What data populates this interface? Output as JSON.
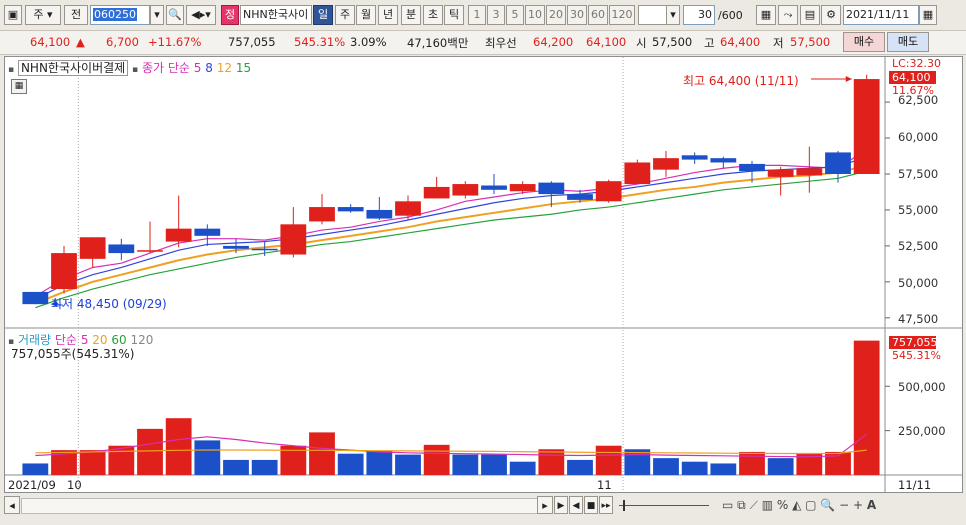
{
  "toolbar": {
    "market": "주",
    "prev": "전",
    "stock_code": "060250",
    "badge": "정",
    "stock_name": "NHN한국사이",
    "periods": [
      "일",
      "주",
      "월",
      "년",
      "분",
      "초",
      "틱"
    ],
    "intervals": [
      "1",
      "3",
      "5",
      "10",
      "20",
      "30",
      "60",
      "120"
    ],
    "count": "30",
    "count_total": "/600",
    "date": "2021/11/11"
  },
  "quote": {
    "price": "64,100",
    "change": "6,700",
    "change_pct": "+11.67%",
    "volume": "757,055",
    "volume_ratio": "545.31%",
    "turnover": "3.09%",
    "amount": "47,160백만",
    "best_label": "최우선",
    "best_ask": "64,200",
    "best_bid": "64,100",
    "open_label": "시",
    "open": "57,500",
    "high_label": "고",
    "high": "64,400",
    "low_label": "저",
    "low": "57,500",
    "buy_button": "매수",
    "sell_button": "매도"
  },
  "price_panel": {
    "stock_label": "NHN한국사이버결제",
    "ma_label": "종가 단순",
    "ma_periods": [
      "5",
      "8",
      "12",
      "15"
    ],
    "ma_colors": [
      "#d62fb5",
      "#3146d8",
      "#f0a020",
      "#27a23a"
    ],
    "lc_label": "LC:32.30",
    "price_tag": "64,100",
    "pct_tag": "11.67%",
    "high_annot": "최고 64,400 (11/11)",
    "low_annot": "최저 48,450 (09/29)",
    "y_ticks": [
      "62,500",
      "60,000",
      "57,500",
      "55,000",
      "52,500",
      "50,000",
      "47,500"
    ]
  },
  "volume_panel": {
    "label": "거래량",
    "ma_label": "단순",
    "ma_periods": [
      "5",
      "20",
      "60",
      "120"
    ],
    "ma_colors": [
      "#d62fb5",
      "#f0a020",
      "#27a23a",
      "#888888"
    ],
    "info": "757,055주(545.31%)",
    "vol_tag": "757,055",
    "pct_tag": "545.31%",
    "y_ticks": [
      "500,000",
      "250,000"
    ]
  },
  "x_axis": {
    "labels": [
      "2021/09",
      "10",
      "11",
      "11/11"
    ]
  },
  "chart_data": [
    {
      "type": "candlestick",
      "title": "NHN한국사이버결제",
      "y_range": [
        47000,
        64800
      ],
      "candles": [
        {
          "o": 49300,
          "h": 49300,
          "l": 48450,
          "c": 48450
        },
        {
          "o": 49500,
          "h": 52500,
          "l": 49200,
          "c": 52000
        },
        {
          "o": 51600,
          "h": 53100,
          "l": 51000,
          "c": 53100
        },
        {
          "o": 52600,
          "h": 53000,
          "l": 51500,
          "c": 52000
        },
        {
          "o": 52200,
          "h": 54200,
          "l": 52000,
          "c": 52200
        },
        {
          "o": 52800,
          "h": 56000,
          "l": 52400,
          "c": 53700
        },
        {
          "o": 53700,
          "h": 54000,
          "l": 52500,
          "c": 53200
        },
        {
          "o": 52500,
          "h": 53000,
          "l": 52000,
          "c": 52300
        },
        {
          "o": 52300,
          "h": 52800,
          "l": 51800,
          "c": 52200
        },
        {
          "o": 51900,
          "h": 55200,
          "l": 51700,
          "c": 54000
        },
        {
          "o": 54200,
          "h": 56100,
          "l": 54000,
          "c": 55200
        },
        {
          "o": 55200,
          "h": 55400,
          "l": 54800,
          "c": 54900
        },
        {
          "o": 55000,
          "h": 55900,
          "l": 54300,
          "c": 54400
        },
        {
          "o": 54600,
          "h": 56000,
          "l": 54300,
          "c": 55600
        },
        {
          "o": 55800,
          "h": 57300,
          "l": 55800,
          "c": 56600
        },
        {
          "o": 56000,
          "h": 57000,
          "l": 55800,
          "c": 56800
        },
        {
          "o": 56700,
          "h": 57500,
          "l": 56100,
          "c": 56400
        },
        {
          "o": 56300,
          "h": 57000,
          "l": 56100,
          "c": 56800
        },
        {
          "o": 56900,
          "h": 57000,
          "l": 55200,
          "c": 56100
        },
        {
          "o": 56100,
          "h": 56400,
          "l": 55500,
          "c": 55700
        },
        {
          "o": 55600,
          "h": 57100,
          "l": 55500,
          "c": 57000
        },
        {
          "o": 56800,
          "h": 58500,
          "l": 56800,
          "c": 58300
        },
        {
          "o": 57800,
          "h": 59100,
          "l": 57300,
          "c": 58600
        },
        {
          "o": 58800,
          "h": 59000,
          "l": 58200,
          "c": 58500
        },
        {
          "o": 58600,
          "h": 58700,
          "l": 57900,
          "c": 58300
        },
        {
          "o": 58200,
          "h": 58400,
          "l": 56900,
          "c": 57700
        },
        {
          "o": 57300,
          "h": 58000,
          "l": 56000,
          "c": 57800
        },
        {
          "o": 57400,
          "h": 59400,
          "l": 56200,
          "c": 57900
        },
        {
          "o": 59000,
          "h": 59100,
          "l": 56900,
          "c": 57500
        },
        {
          "o": 57500,
          "h": 64400,
          "l": 57500,
          "c": 64100
        }
      ],
      "ma": [
        {
          "period": 5,
          "values": [
            49000,
            50200,
            51000,
            51300,
            52000,
            52700,
            53000,
            53000,
            52900,
            53200,
            53600,
            53800,
            54200,
            54500,
            55000,
            55600,
            55900,
            56200,
            56400,
            56300,
            56500,
            56800,
            57200,
            57600,
            57900,
            58100,
            58100,
            58000,
            57900,
            59200
          ]
        },
        {
          "period": 8,
          "values": [
            48800,
            49800,
            50500,
            51000,
            51600,
            52200,
            52600,
            52700,
            52800,
            53000,
            53300,
            53600,
            53900,
            54300,
            54700,
            55100,
            55500,
            55800,
            56000,
            56100,
            56300,
            56600,
            56900,
            57200,
            57500,
            57700,
            57800,
            57900,
            58000,
            58700
          ]
        },
        {
          "period": 12,
          "values": [
            48500,
            49300,
            50000,
            50500,
            51000,
            51500,
            51900,
            52200,
            52400,
            52600,
            52900,
            53200,
            53500,
            53800,
            54200,
            54500,
            54800,
            55100,
            55400,
            55600,
            55800,
            56100,
            56400,
            56600,
            56900,
            57100,
            57300,
            57400,
            57600,
            58100
          ]
        },
        {
          "period": 15,
          "values": [
            48200,
            48900,
            49500,
            50000,
            50500,
            50900,
            51300,
            51700,
            52000,
            52300,
            52600,
            52800,
            53100,
            53400,
            53700,
            54000,
            54300,
            54500,
            54700,
            55000,
            55200,
            55500,
            55800,
            56100,
            56400,
            56600,
            56800,
            57000,
            57200,
            57700
          ]
        }
      ]
    },
    {
      "type": "bar",
      "title": "거래량",
      "y_range": [
        0,
        800000
      ],
      "bars": [
        {
          "v": 65000,
          "up": false
        },
        {
          "v": 140000,
          "up": true
        },
        {
          "v": 140000,
          "up": true
        },
        {
          "v": 165000,
          "up": true
        },
        {
          "v": 260000,
          "up": true
        },
        {
          "v": 320000,
          "up": true
        },
        {
          "v": 195000,
          "up": false
        },
        {
          "v": 85000,
          "up": false
        },
        {
          "v": 85000,
          "up": false
        },
        {
          "v": 165000,
          "up": true
        },
        {
          "v": 240000,
          "up": true
        },
        {
          "v": 120000,
          "up": false
        },
        {
          "v": 135000,
          "up": false
        },
        {
          "v": 115000,
          "up": false
        },
        {
          "v": 170000,
          "up": true
        },
        {
          "v": 115000,
          "up": false
        },
        {
          "v": 115000,
          "up": false
        },
        {
          "v": 75000,
          "up": false
        },
        {
          "v": 145000,
          "up": true
        },
        {
          "v": 85000,
          "up": false
        },
        {
          "v": 165000,
          "up": true
        },
        {
          "v": 145000,
          "up": false
        },
        {
          "v": 95000,
          "up": false
        },
        {
          "v": 75000,
          "up": false
        },
        {
          "v": 65000,
          "up": false
        },
        {
          "v": 130000,
          "up": true
        },
        {
          "v": 95000,
          "up": false
        },
        {
          "v": 120000,
          "up": true
        },
        {
          "v": 130000,
          "up": true
        },
        {
          "v": 757055,
          "up": true
        }
      ],
      "ma5": [
        110000,
        118000,
        130000,
        150000,
        175000,
        200000,
        215000,
        200000,
        180000,
        165000,
        150000,
        140000,
        130000,
        125000,
        122000,
        120000,
        118000,
        115000,
        112000,
        110000,
        112000,
        115000,
        112000,
        110000,
        108000,
        106000,
        104000,
        103000,
        108000,
        230000
      ],
      "ma20": [
        125000,
        127000,
        130000,
        133000,
        136000,
        139000,
        141000,
        141000,
        140000,
        139000,
        139000,
        138000,
        137000,
        136000,
        135000,
        134000,
        133000,
        131000,
        130000,
        128000,
        127000,
        126000,
        125000,
        124000,
        123000,
        122000,
        121000,
        121000,
        122000,
        140000
      ]
    }
  ]
}
